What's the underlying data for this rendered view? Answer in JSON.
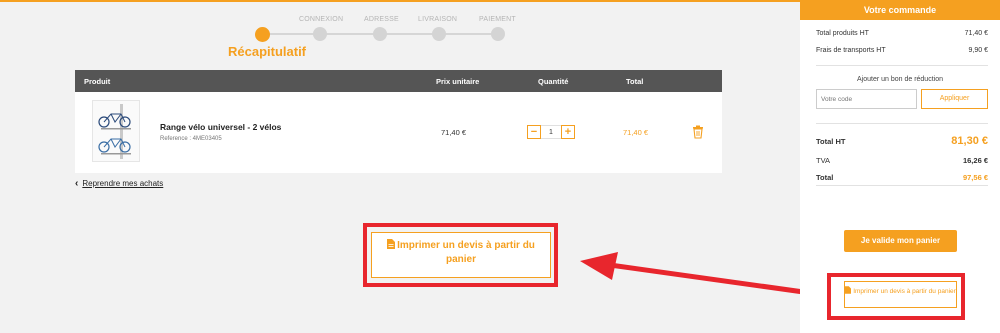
{
  "colors": {
    "accent": "#f5a020",
    "header": "#555555",
    "highlight": "#e8262d",
    "inactive": "#d4d4d4"
  },
  "stepper": {
    "active_label": "Récapitulatif",
    "steps": [
      "CONNEXION",
      "ADRESSE",
      "LIVRAISON",
      "PAIEMENT"
    ]
  },
  "cart": {
    "columns": {
      "product": "Produit",
      "unit_price": "Prix unitaire",
      "quantity": "Quantité",
      "total": "Total"
    },
    "item": {
      "name": "Range vélo universel - 2 vélos",
      "reference": "Reference : 4ME03405",
      "unit_price": "71,40 €",
      "quantity": "1",
      "total": "71,40 €",
      "image_icon": "bike-rack-product-image",
      "delete_icon": "trash-icon"
    },
    "back_link": "Reprendre mes achats"
  },
  "main_quote_button": "Imprimer un devis à partir du panier",
  "sidebar": {
    "title": "Votre commande",
    "rows": [
      {
        "label": "Total produits HT",
        "value": "71,40 €"
      },
      {
        "label": "Frais de transports HT",
        "value": "9,90 €"
      }
    ],
    "promo": {
      "title": "Ajouter un bon de réduction",
      "placeholder": "Votre code",
      "button": "Appliquer"
    },
    "total_ht": {
      "label": "Total HT",
      "value": "81,30 €"
    },
    "tva": {
      "label": "TVA",
      "value": "16,26 €"
    },
    "total": {
      "label": "Total",
      "value": "97,56 €"
    },
    "validate_button": "Je valide mon panier",
    "quote_button": "Imprimer un devis à partir du panier"
  }
}
